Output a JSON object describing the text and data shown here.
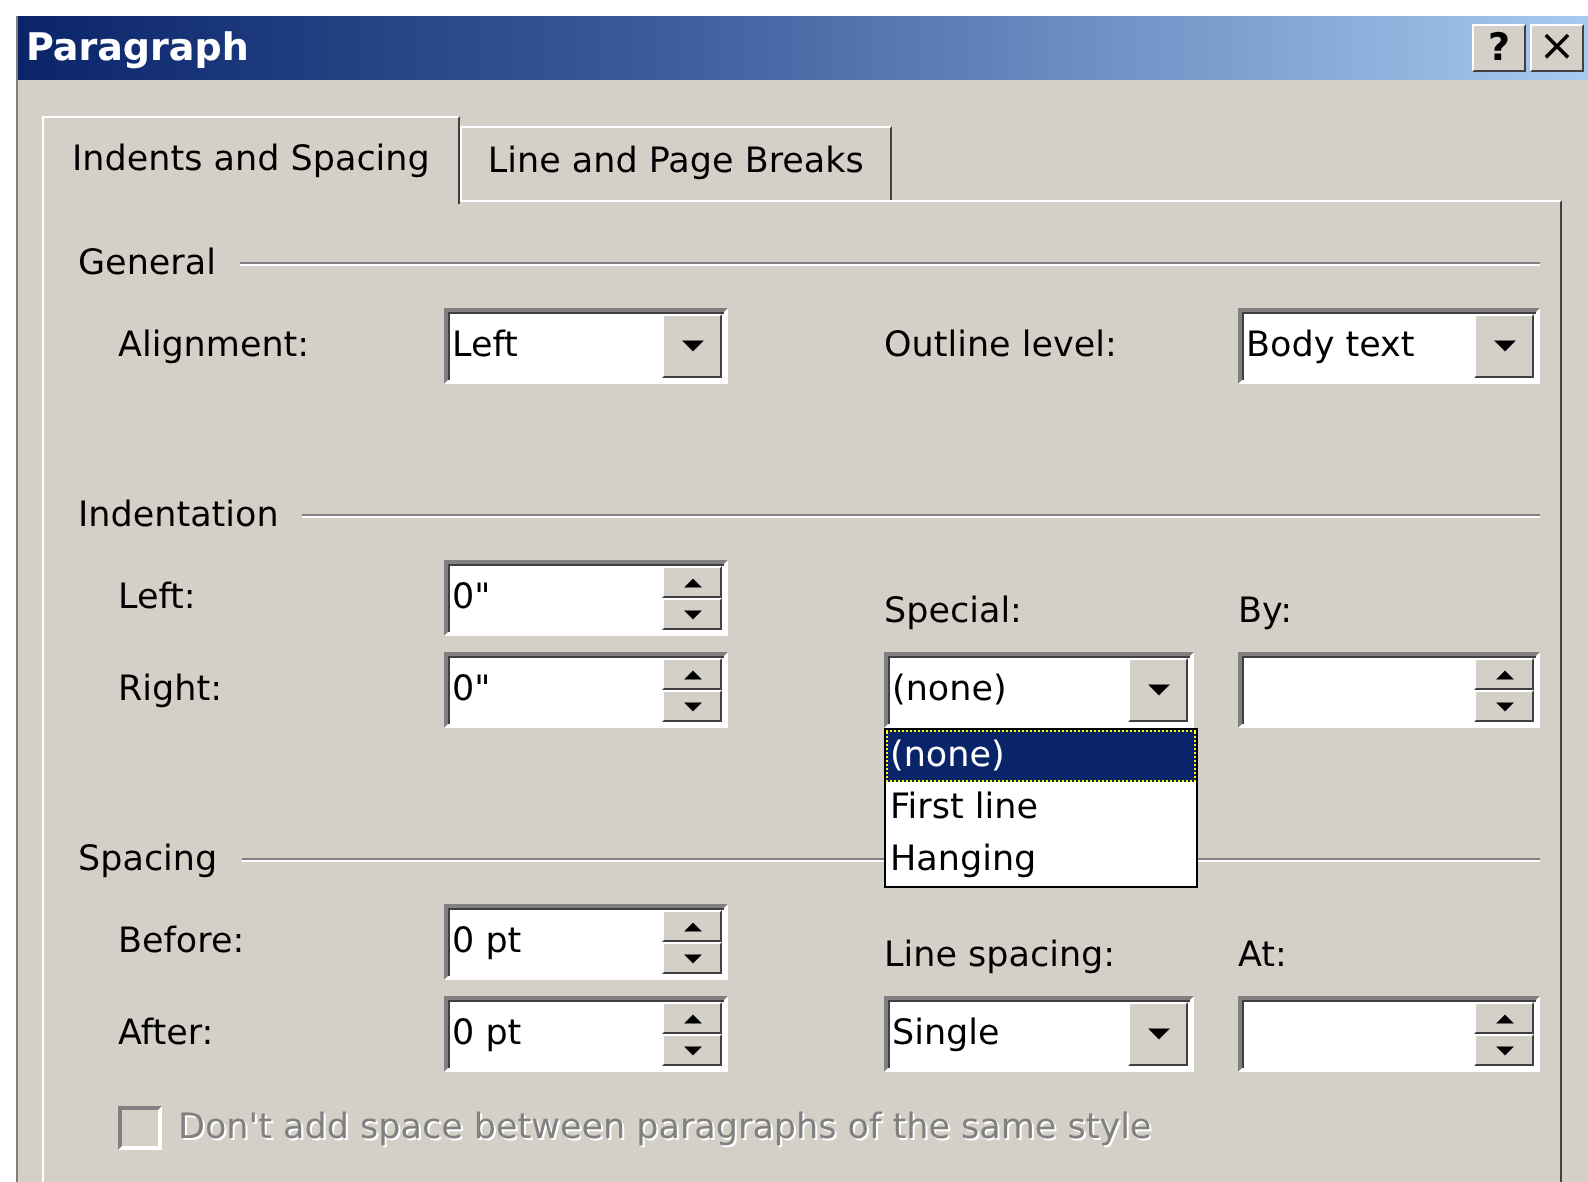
{
  "window": {
    "title": "Paragraph",
    "controls": [
      {
        "kind": "help",
        "label": "?"
      },
      {
        "kind": "close",
        "label": "×"
      }
    ]
  },
  "tabs": [
    {
      "label": "Indents and Spacing",
      "selected": true
    },
    {
      "label": "Line and Page Breaks",
      "selected": false
    }
  ],
  "groups": [
    {
      "title": "General",
      "left": [
        {
          "label": "Alignment:",
          "kind": "combo",
          "value": "Left"
        }
      ],
      "right": [
        {
          "label": "Outline level:",
          "kind": "combo",
          "value": "Body text",
          "label_above": false
        }
      ]
    },
    {
      "title": "Indentation",
      "left": [
        {
          "label": "Left:",
          "kind": "spin",
          "value": "0\""
        },
        {
          "label": "Right:",
          "kind": "spin",
          "value": "0\""
        }
      ],
      "right": [
        {
          "label": "Special:",
          "kind": "combo",
          "value": "(none)",
          "label_above": true,
          "open": true,
          "options": [
            {
              "label": "(none)",
              "selected": true
            },
            {
              "label": "First line",
              "selected": false
            },
            {
              "label": "Hanging",
              "selected": false
            }
          ]
        },
        {
          "label": "By:",
          "kind": "spin",
          "label_above": true
        }
      ]
    },
    {
      "title": "Spacing",
      "left": [
        {
          "label": "Before:",
          "kind": "spin",
          "value": "0 pt"
        },
        {
          "label": "After:",
          "kind": "spin",
          "value": "0 pt"
        }
      ],
      "right": [
        {
          "label": "Line spacing:",
          "kind": "combo",
          "value": "Single",
          "label_above": true
        },
        {
          "label": "At:",
          "kind": "spin",
          "label_above": true
        }
      ]
    }
  ],
  "checkbox": {
    "label": "Don't add space between paragraphs of the same style",
    "checked": false,
    "disabled": true
  }
}
